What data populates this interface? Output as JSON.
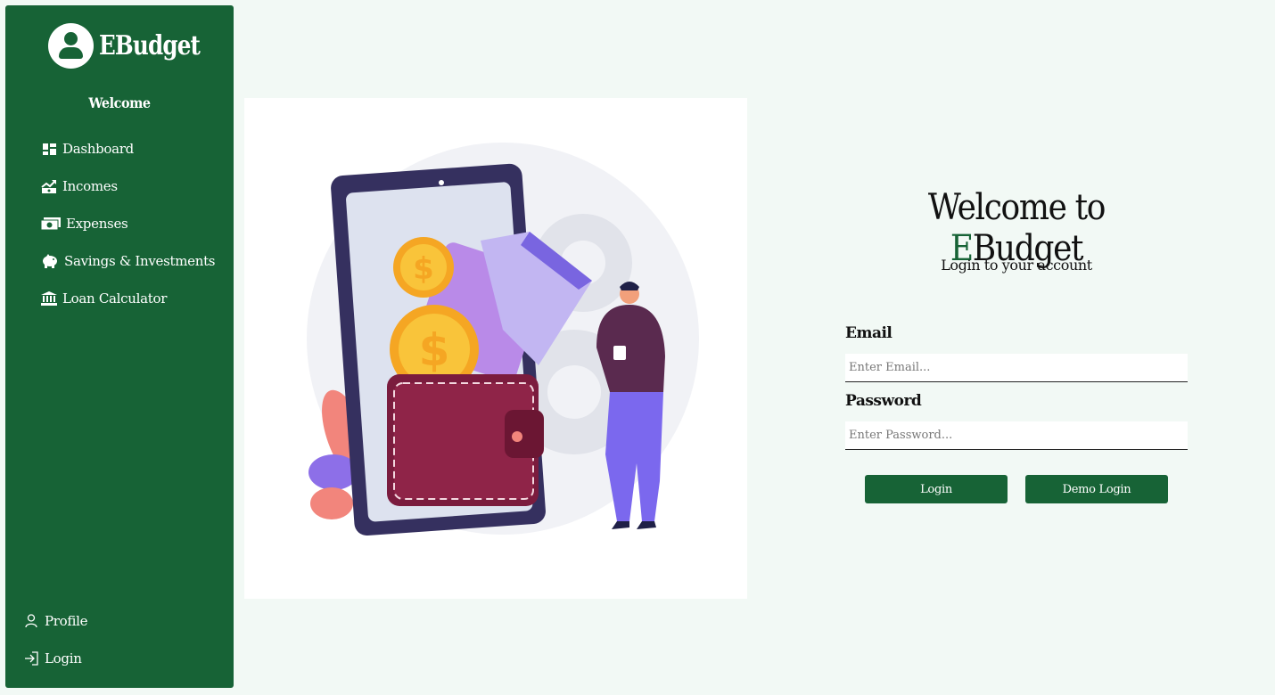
{
  "sidebar": {
    "brand": "EBudget",
    "welcome": "Welcome",
    "items": [
      {
        "label": "Dashboard",
        "icon": "dashboard-icon"
      },
      {
        "label": "Incomes",
        "icon": "trending-up-icon"
      },
      {
        "label": "Expenses",
        "icon": "money-bill-icon"
      },
      {
        "label": "Savings & Investments",
        "icon": "piggy-bank-icon"
      },
      {
        "label": "Loan Calculator",
        "icon": "bank-icon"
      }
    ],
    "bottom": [
      {
        "label": "Profile",
        "icon": "user-icon"
      },
      {
        "label": "Login",
        "icon": "login-icon"
      }
    ]
  },
  "login": {
    "title_prefix": "Welcome to ",
    "title_accent_letter": "E",
    "title_rest": "Budget",
    "subtitle": "Login to your account",
    "email_label": "Email",
    "email_placeholder": "Enter Email...",
    "password_label": "Password",
    "password_placeholder": "Enter Password...",
    "login_button": "Login",
    "demo_button": "Demo Login"
  },
  "colors": {
    "primary": "#176336",
    "background": "#f2f9f5"
  }
}
